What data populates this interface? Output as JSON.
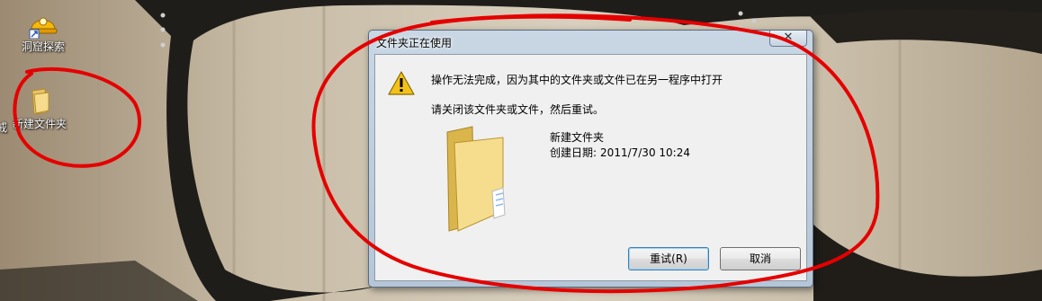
{
  "desktop": {
    "icons": [
      {
        "label": "洞窟探索",
        "icon": "helmet-app-icon"
      },
      {
        "label": "新建文件夹",
        "icon": "folder-icon"
      }
    ],
    "edge_fragment": "戒"
  },
  "dialog": {
    "title": "文件夹正在使用",
    "close_symbol": "✕",
    "message_main": "操作无法完成，因为其中的文件夹或文件已在另一程序中打开",
    "message_sub": "请关闭该文件夹或文件，然后重试。",
    "file": {
      "name": "新建文件夹",
      "date_label": "创建日期:",
      "date_value": "2011/7/30 10:24"
    },
    "buttons": {
      "retry": "重试(R)",
      "cancel": "取消"
    }
  },
  "colors": {
    "annotation": "#e50000",
    "warning": "#f3c21a",
    "folder": "#f2d785"
  }
}
